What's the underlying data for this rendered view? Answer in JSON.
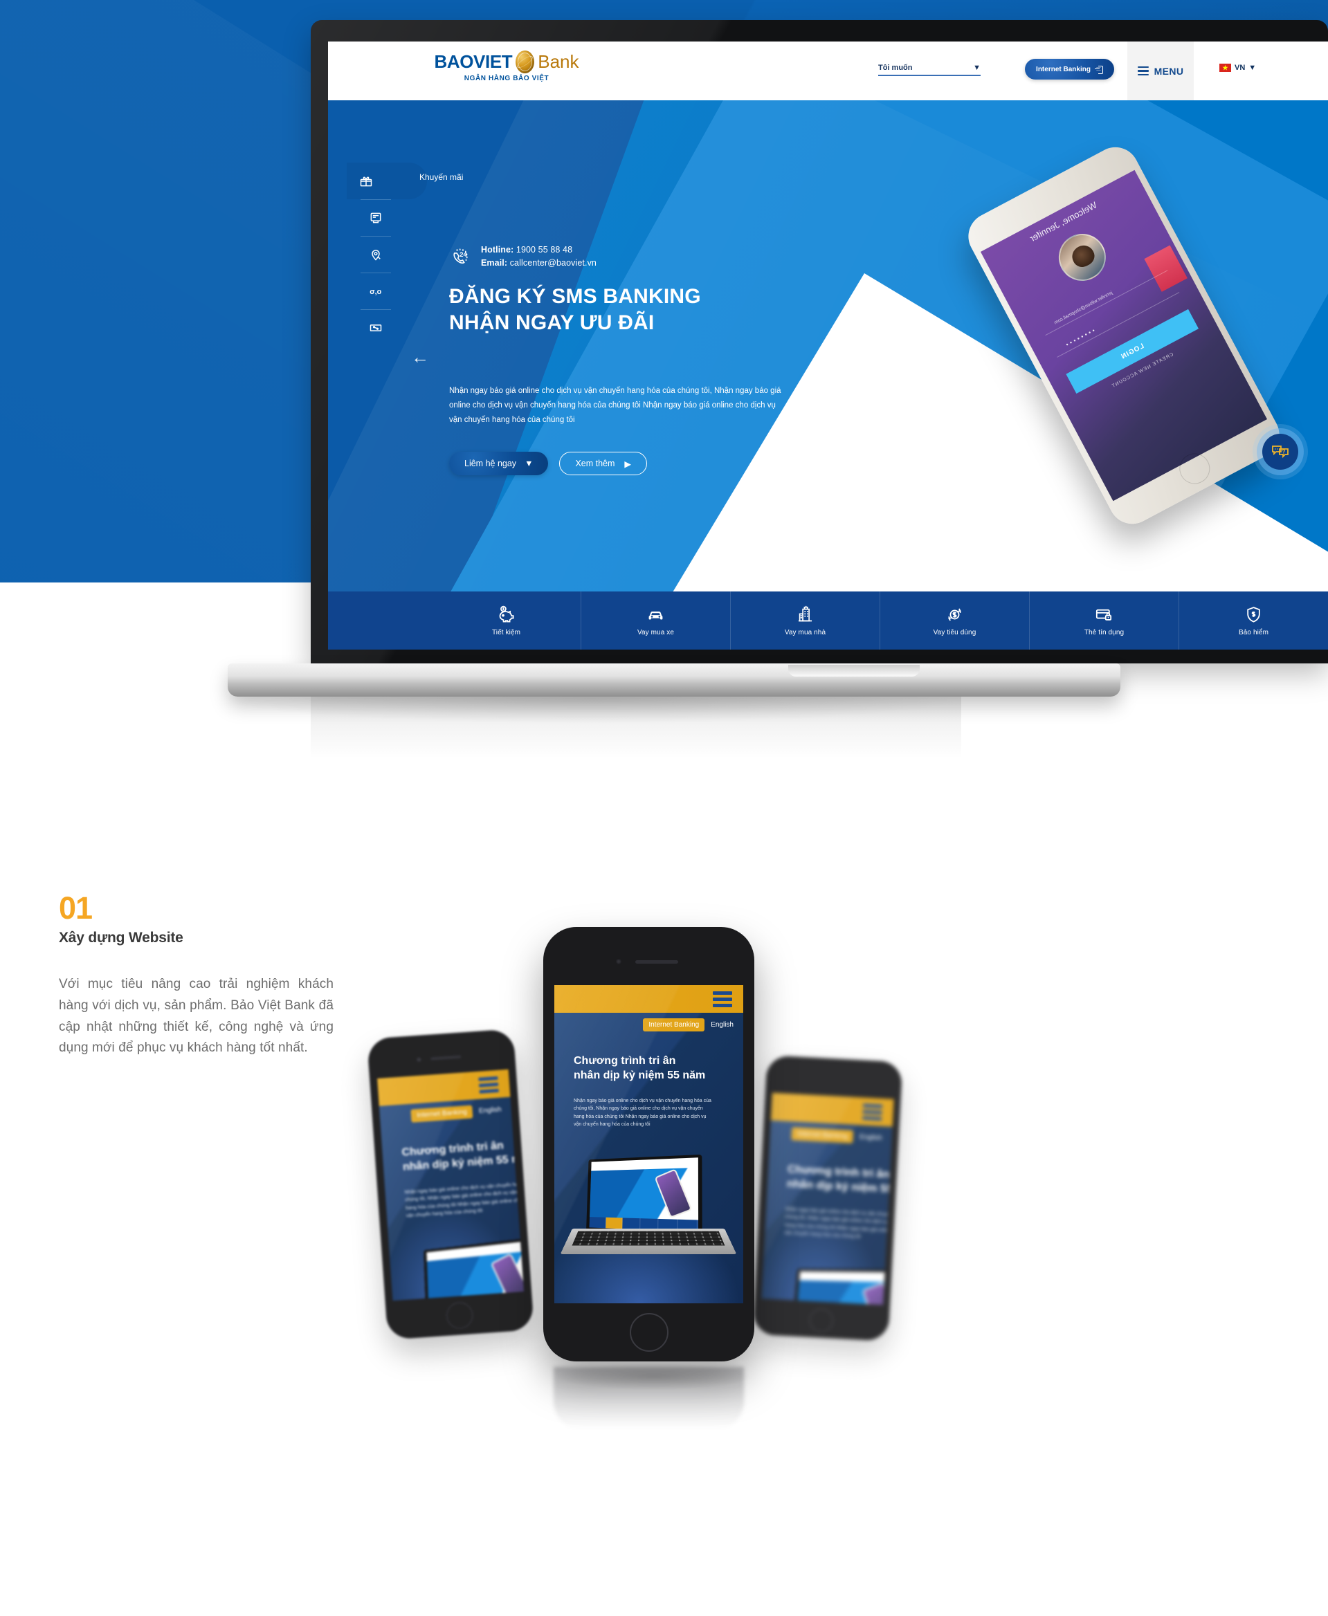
{
  "brand": {
    "name": "BAOVIET",
    "bank_word": "Bank",
    "tagline": "NGÂN HÀNG BẢO VIỆT",
    "accent_blue": "#00529c",
    "accent_gold": "#b9790b",
    "hero_blue": "#0077c8",
    "deep_blue": "#10448e",
    "orange": "#f5a623"
  },
  "header": {
    "select_label": "Tôi muốn",
    "internet_banking": "Internet Banking",
    "menu_label": "MENU",
    "language": "VN"
  },
  "hero": {
    "rail": [
      {
        "label": "Khuyến mãi",
        "icon": "gift-icon"
      },
      {
        "label": "",
        "icon": "atm-icon"
      },
      {
        "label": "",
        "icon": "location-search-icon"
      },
      {
        "label": "",
        "icon": "exchange-rate-icon"
      },
      {
        "label": "",
        "icon": "interest-rate-icon"
      }
    ],
    "rail_active_label": "Khuyến mãi",
    "hotline_label": "Hotline:",
    "hotline_value": "1900 55 88 48",
    "email_label": "Email:",
    "email_value": "callcenter@baoviet.vn",
    "title_line1": "ĐĂNG KÝ SMS BANKING",
    "title_line2": "NHẬN NGAY ƯU ĐÃI",
    "paragraph": "Nhận ngay báo giá online cho dịch vụ vận chuyến hang hóa của chúng tôi, Nhận ngay báo giá online cho dịch vụ vận chuyến hang hóa của chúng tôi Nhận ngay báo giá online cho dịch vụ vận chuyến hang hóa của chúng tôi",
    "btn_primary": "Liêm hệ ngay",
    "btn_secondary": "Xem thêm",
    "carousel_dots": 4,
    "carousel_active": 1,
    "chat_icon": "chat-help-icon"
  },
  "hero_phone": {
    "welcome": "Welcome, Jennifer",
    "email_value": "jennifer.wilson@shopmail.com",
    "password_mask": "••••••••",
    "login_button": "LOGIN",
    "create_account": "CREATE NEW ACCOUNT"
  },
  "services": [
    {
      "label": "Tiết kiệm",
      "icon": "piggy-bank-icon"
    },
    {
      "label": "Vay mua xe",
      "icon": "car-icon"
    },
    {
      "label": "Vay mua nhà",
      "icon": "building-icon"
    },
    {
      "label": "Vay tiêu dùng",
      "icon": "dollar-refresh-icon"
    },
    {
      "label": "Thẻ tín dụng",
      "icon": "credit-card-lock-icon"
    },
    {
      "label": "Bảo hiểm",
      "icon": "shield-dollar-icon"
    }
  ],
  "section": {
    "number": "01",
    "title": "Xây dựng Website",
    "body": "Với mục tiêu nâng cao trải nghiệm khách hàng với dịch vụ, sản phẩm. Bảo Việt Bank đã cập nhật những thiết kế, công nghệ và ứng dụng mới để phục vụ khách hàng tốt nhất."
  },
  "mobile": {
    "internet_banking": "Internet Banking",
    "english": "English",
    "title_line1": "Chương trình tri ân",
    "title_line2": "nhân dịp kỷ niệm 55 năm",
    "paragraph": "Nhận ngay báo giá online cho dịch vụ vận chuyến hang hóa của chúng tôi, Nhận ngay báo giá online cho dịch vụ vận chuyến hang hóa của chúng tôi Nhận ngay báo giá online cho dịch vụ vận chuyến hang hóa của chúng tôi"
  }
}
